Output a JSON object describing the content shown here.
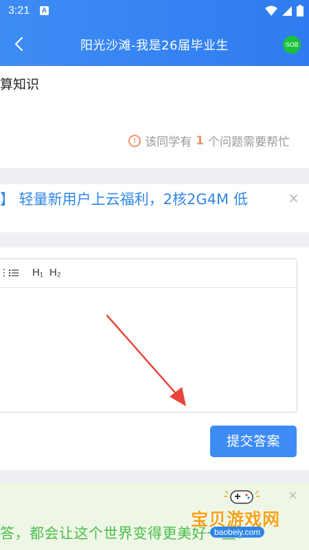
{
  "status_bar": {
    "time": "3:21",
    "app_badge": "A"
  },
  "app_bar": {
    "title": "阳光沙滩-我是26届毕业生",
    "avatar_text": "SOB"
  },
  "question": {
    "text_fragment": "算知识"
  },
  "help": {
    "prefix": "该同学有",
    "count": "1",
    "suffix": "个问题需要帮忙"
  },
  "promo": {
    "text": "】 轻量新用户上云福利，2核2G4M 低",
    "close": "×"
  },
  "editor": {
    "toolbar": {
      "h1": "H₁",
      "h2": "H₂"
    }
  },
  "submit": {
    "label": "提交答案"
  },
  "footer": {
    "text": "答，都会让这个世界变得更美好一些！",
    "close": "×"
  },
  "watermark": {
    "text": "宝贝游戏网",
    "url": "baobeiy.com"
  },
  "colors": {
    "primary": "#2f7cf0",
    "warning": "#f0926a",
    "footer_green": "#4cbc4c",
    "promo_blue": "#2f86e6"
  }
}
